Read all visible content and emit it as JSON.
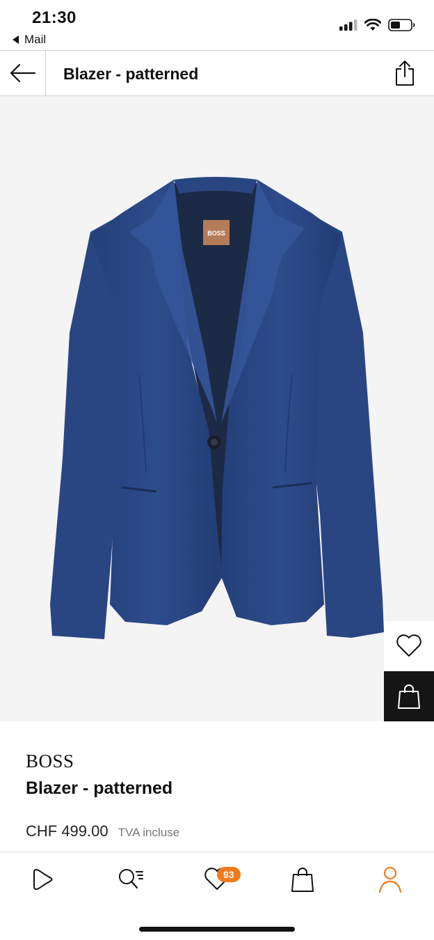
{
  "status": {
    "time": "21:30",
    "back_app": "Mail"
  },
  "header": {
    "title": "Blazer - patterned",
    "back_icon": "arrow-left-icon",
    "share_icon": "share-icon"
  },
  "product": {
    "label_text": "BOSS",
    "brand": "BOSS",
    "name": "Blazer - patterned",
    "price": "CHF 499.00",
    "vat_note": "TVA incluse"
  },
  "bottom_nav": {
    "wishlist_badge": "93",
    "items": [
      "home-icon",
      "search-icon",
      "wishlist-icon",
      "bag-icon",
      "profile-icon"
    ],
    "active_color": "#f07b1f"
  },
  "colors": {
    "accent": "#f07b1f",
    "blazer": "#2b4a86",
    "image_bg": "#f4f4f4"
  }
}
